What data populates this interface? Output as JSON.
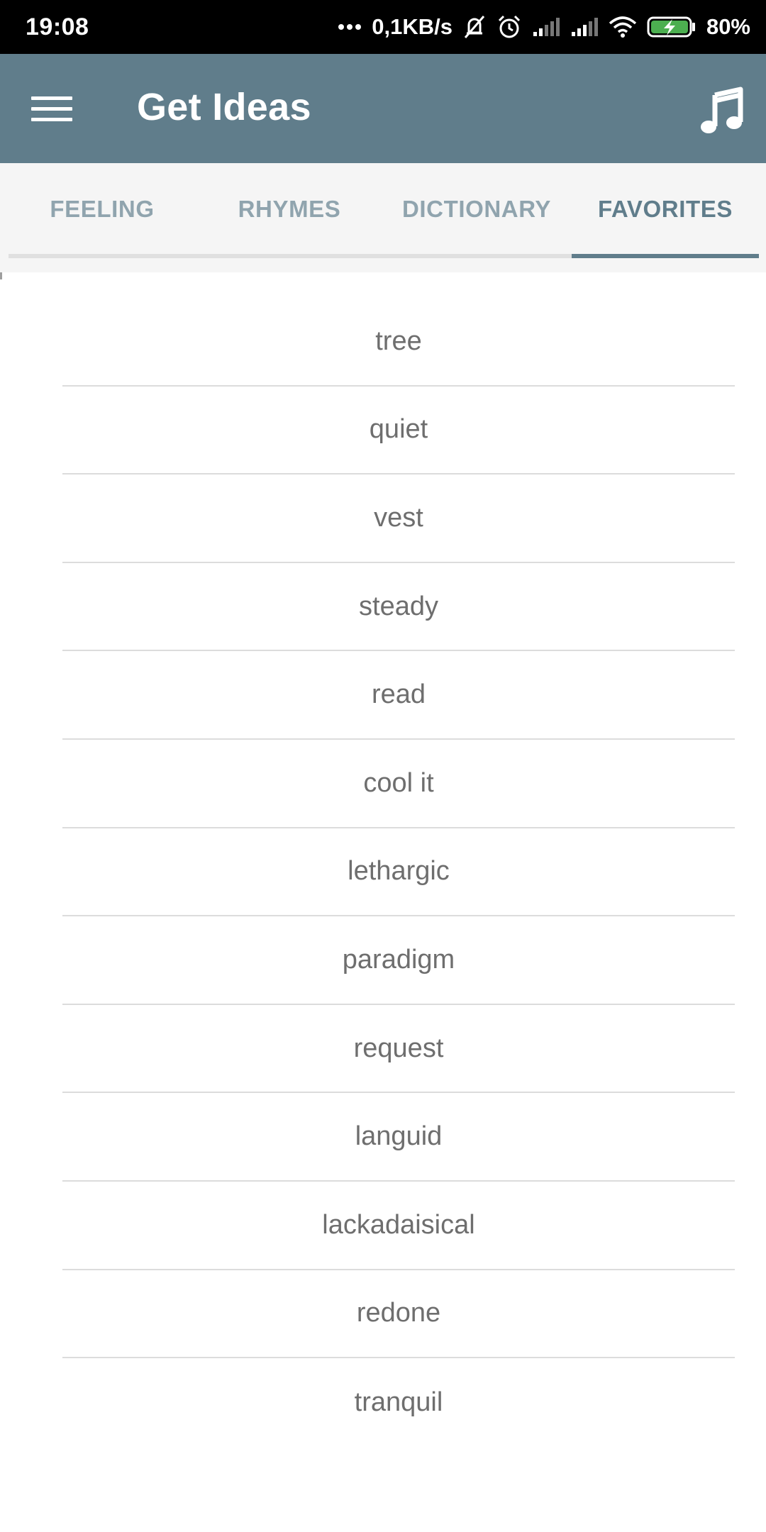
{
  "status_bar": {
    "time": "19:08",
    "network_speed": "0,1KB/s",
    "battery_percent": "80%",
    "icons": [
      "more-dots-icon",
      "bell-muted-icon",
      "alarm-icon",
      "signal-icon",
      "signal-icon",
      "wifi-icon",
      "battery-charging-icon"
    ]
  },
  "app_bar": {
    "title": "Get Ideas",
    "left_icon": "menu-icon",
    "right_icon": "music-note-icon",
    "background_color": "#607d8b"
  },
  "tabs": {
    "items": [
      "FEELING",
      "RHYMES",
      "DICTIONARY",
      "FAVORITES"
    ],
    "selected": "FAVORITES",
    "active_color": "#607d8b",
    "inactive_color": "#90a4ae"
  },
  "favorites": [
    "tree",
    "quiet",
    "vest",
    "steady",
    "read",
    "cool it",
    "lethargic",
    "paradigm",
    "request",
    "languid",
    "lackadaisical",
    "redone",
    "tranquil"
  ]
}
